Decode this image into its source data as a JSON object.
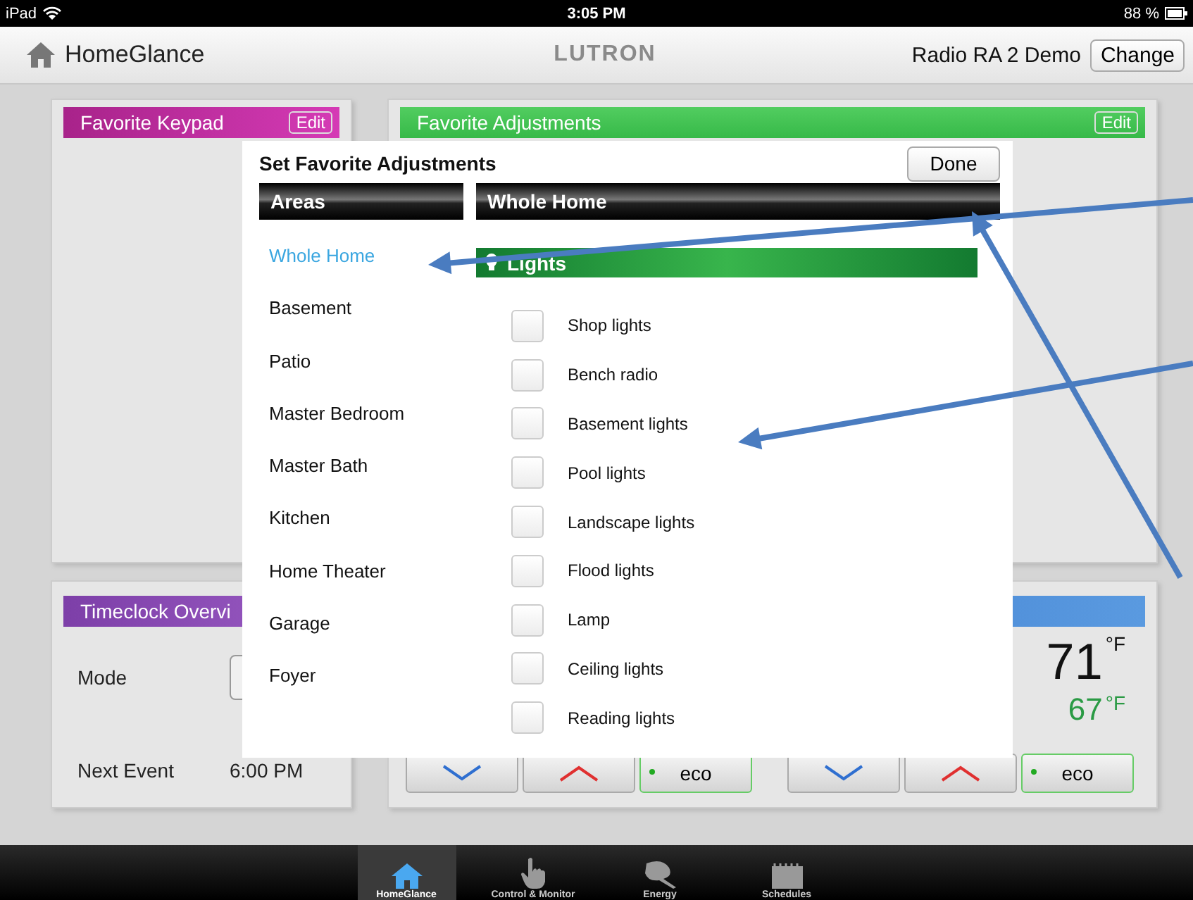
{
  "status_bar": {
    "carrier": "iPad",
    "time": "3:05 PM",
    "battery": "88 %"
  },
  "header": {
    "title": "HomeGlance",
    "logo": "LUTRON",
    "system": "Radio RA 2 Demo",
    "change_button": "Change"
  },
  "favorite_keypad": {
    "title": "Favorite Keypad",
    "edit_button": "Edit"
  },
  "favorite_adjustments": {
    "title": "Favorite Adjustments",
    "edit_button": "Edit"
  },
  "timeclock": {
    "title": "Timeclock Overvi",
    "mode_label": "Mode",
    "next_event_label": "Next Event",
    "next_event": "6:00 PM"
  },
  "thermostat": {
    "temperature": "71",
    "temperature_unit": "°F",
    "setpoint": "67",
    "setpoint_unit": "°F",
    "buttons": [
      {
        "kind": "down"
      },
      {
        "kind": "up"
      },
      {
        "kind": "eco",
        "label": "eco"
      },
      {
        "kind": "down"
      },
      {
        "kind": "up"
      },
      {
        "kind": "eco",
        "label": "eco"
      }
    ]
  },
  "dialog": {
    "title": "Set Favorite Adjustments",
    "done_button": "Done",
    "areas_header": "Areas",
    "zone_header": "Whole Home",
    "group_header": "Lights",
    "areas": [
      {
        "label": "Whole Home",
        "selected": true
      },
      {
        "label": "Basement",
        "selected": false
      },
      {
        "label": "Patio",
        "selected": false
      },
      {
        "label": "Master Bedroom",
        "selected": false
      },
      {
        "label": "Master Bath",
        "selected": false
      },
      {
        "label": "Kitchen",
        "selected": false
      },
      {
        "label": "Home Theater",
        "selected": false
      },
      {
        "label": "Garage",
        "selected": false
      },
      {
        "label": "Foyer",
        "selected": false
      }
    ],
    "loads": [
      {
        "label": "Shop lights",
        "checked": false
      },
      {
        "label": "Bench radio",
        "checked": false
      },
      {
        "label": "Basement lights",
        "checked": false
      },
      {
        "label": "Pool lights",
        "checked": false
      },
      {
        "label": "Landscape lights",
        "checked": false
      },
      {
        "label": "Flood lights",
        "checked": false
      },
      {
        "label": "Lamp",
        "checked": false
      },
      {
        "label": "Ceiling lights",
        "checked": false
      },
      {
        "label": "Reading lights",
        "checked": false
      }
    ]
  },
  "tab_bar": [
    {
      "kind": "home",
      "label": "HomeGlance",
      "selected": true
    },
    {
      "kind": "hand",
      "label": "Control & Monitor",
      "selected": false
    },
    {
      "kind": "energy",
      "label": "Energy",
      "selected": false
    },
    {
      "kind": "schedule",
      "label": "Schedules",
      "selected": false
    }
  ]
}
